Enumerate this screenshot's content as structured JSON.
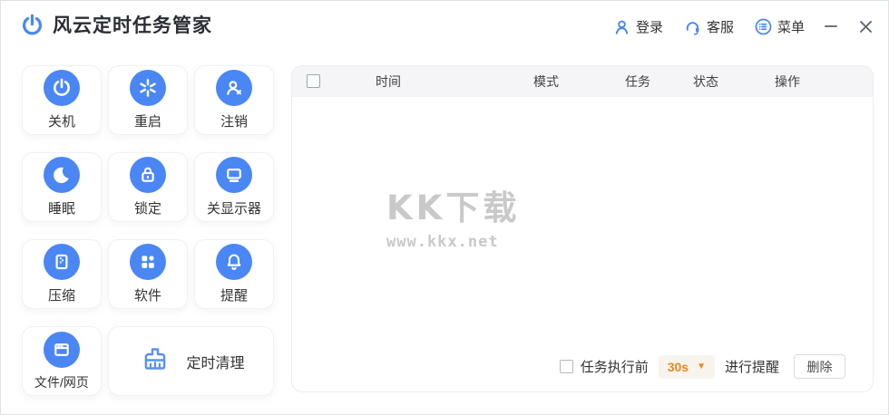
{
  "titlebar": {
    "app_title": "风云定时任务管家",
    "login_label": "登录",
    "service_label": "客服",
    "menu_label": "菜单"
  },
  "sidebar": {
    "items": [
      {
        "label": "关机",
        "icon": "power-icon"
      },
      {
        "label": "重启",
        "icon": "restart-icon"
      },
      {
        "label": "注销",
        "icon": "logout-user-icon"
      },
      {
        "label": "睡眠",
        "icon": "moon-icon"
      },
      {
        "label": "锁定",
        "icon": "lock-icon"
      },
      {
        "label": "关显示器",
        "icon": "monitor-icon"
      },
      {
        "label": "压缩",
        "icon": "zip-file-icon"
      },
      {
        "label": "软件",
        "icon": "apps-grid-icon"
      },
      {
        "label": "提醒",
        "icon": "bell-icon"
      },
      {
        "label": "文件/网页",
        "icon": "browser-icon"
      }
    ],
    "clean_item": {
      "label": "定时清理",
      "icon": "broom-icon"
    }
  },
  "table": {
    "columns": [
      "时间",
      "模式",
      "任务",
      "状态",
      "操作"
    ]
  },
  "watermark": {
    "title": "KK下载",
    "url": "www.kkx.net"
  },
  "footer": {
    "before_label": "任务执行前",
    "interval_value": "30s",
    "dropdown_icon": "▼",
    "after_label": "进行提醒",
    "delete_label": "删除"
  },
  "colors": {
    "accent_blue": "#4a87f5",
    "accent_orange": "#f0861c",
    "watermark_gray": "#c9c9c9",
    "header_bg": "#f5f5f7"
  }
}
